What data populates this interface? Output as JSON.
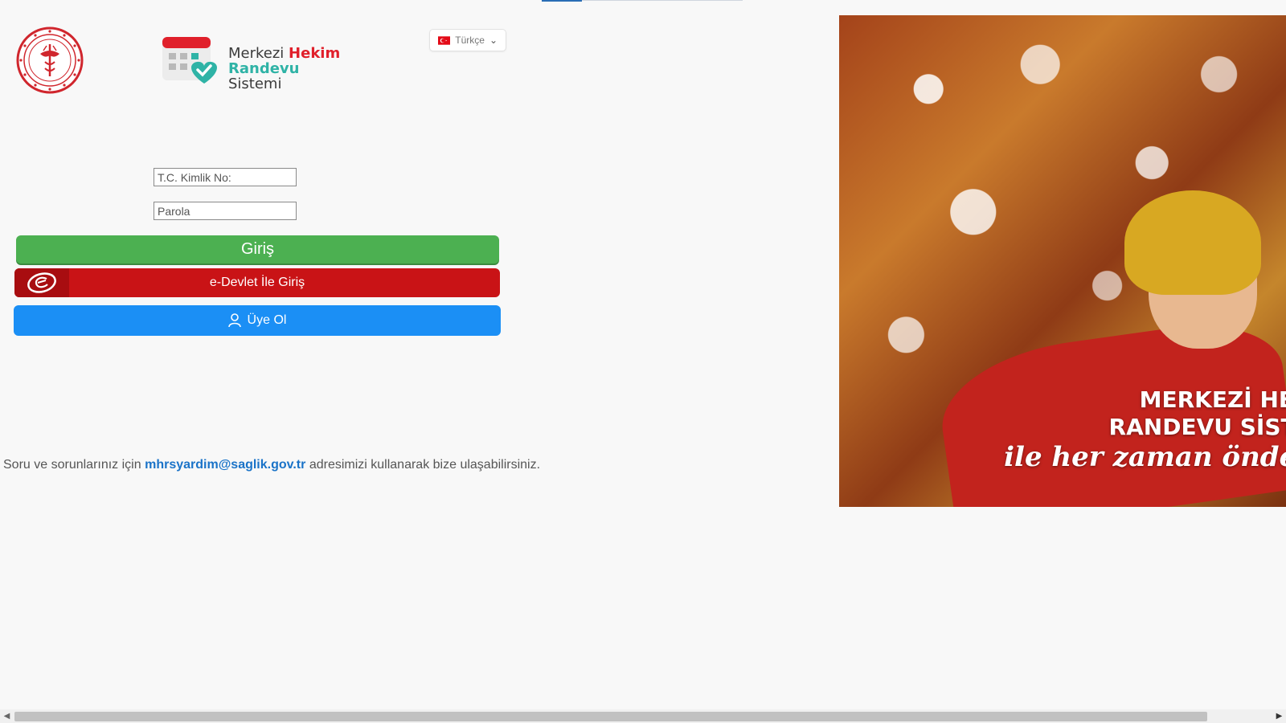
{
  "app": {
    "title_part1": "Merkezi",
    "title_part2": "Hekim",
    "title_part3": "Randevu",
    "title_part4": "Sistemi"
  },
  "language": {
    "selected": "Türkçe",
    "flag_icon": "turkey-flag-icon"
  },
  "login": {
    "tc_placeholder": "T.C. Kimlik No:",
    "password_placeholder": "Parola",
    "login_button": "Giriş",
    "edevlet_button": "e-Devlet İle Giriş",
    "signup_button": "Üye Ol"
  },
  "help": {
    "prefix": "Soru ve sorunlarınız için",
    "email": "mhrsyardim@saglik.gov.tr",
    "suffix": "adresimizi kullanarak bize ulaşabilirsiniz."
  },
  "hero": {
    "line1": "MERKEZİ HEKİM",
    "line2": "RANDEVU SİSTEMİ",
    "line3": "ile her zaman öndesin"
  },
  "colors": {
    "login_green": "#4cb051",
    "edevlet_red": "#c91316",
    "signup_blue": "#1b8ff5",
    "brand_red": "#e0202b",
    "brand_teal": "#2fb3a6",
    "link_blue": "#1a73c8"
  }
}
